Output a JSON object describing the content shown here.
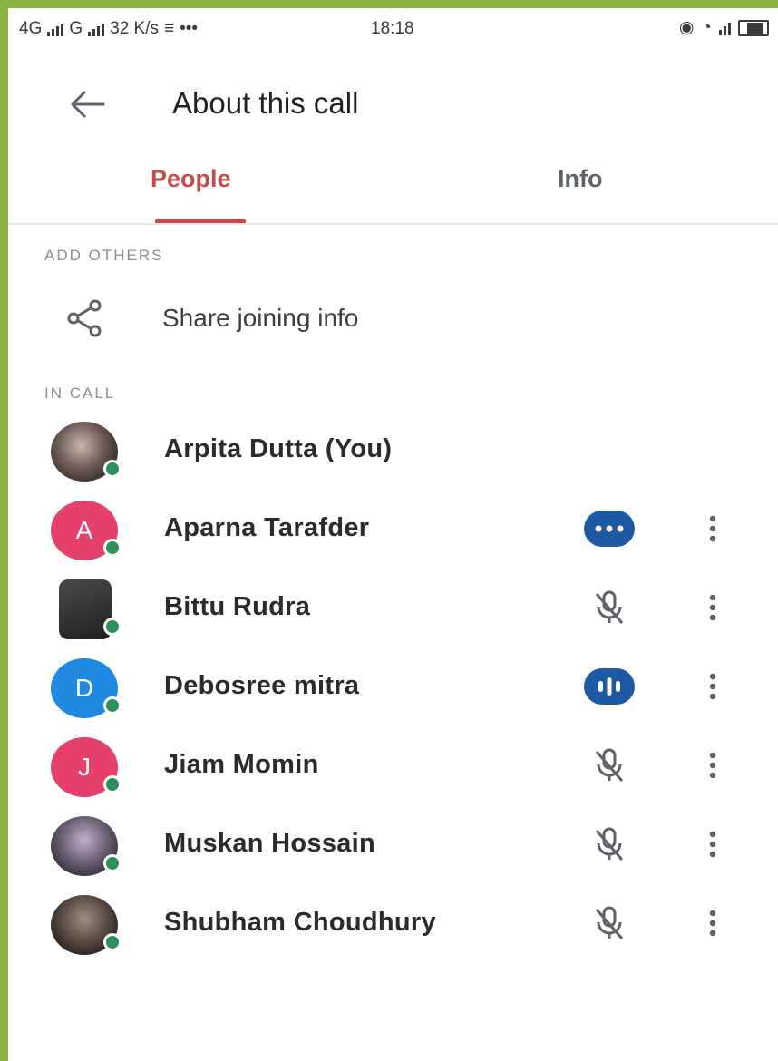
{
  "status_bar": {
    "network1": "4G",
    "network2": "G",
    "speed": "32 K/s",
    "dots": "•••",
    "time": "18:18"
  },
  "header": {
    "title": "About this call",
    "back_icon": "arrow-back-icon"
  },
  "tabs": [
    {
      "label": "People",
      "active": true
    },
    {
      "label": "Info",
      "active": false
    }
  ],
  "add_others": {
    "section_label": "ADD OTHERS",
    "share_label": "Share joining info",
    "share_icon": "share-icon"
  },
  "in_call": {
    "section_label": "IN CALL",
    "participants": [
      {
        "name": "Arpita Dutta (You)",
        "initial": "",
        "avatar": "photo",
        "status": "none"
      },
      {
        "name": "Aparna Tarafder",
        "initial": "A",
        "avatar": "pink",
        "status": "active"
      },
      {
        "name": "Bittu Rudra",
        "initial": "",
        "avatar": "photo",
        "status": "muted"
      },
      {
        "name": "Debosree mitra",
        "initial": "D",
        "avatar": "blue",
        "status": "speaking"
      },
      {
        "name": "Jiam Momin",
        "initial": "J",
        "avatar": "pink",
        "status": "muted"
      },
      {
        "name": "Muskan Hossain",
        "initial": "",
        "avatar": "photo",
        "status": "muted"
      },
      {
        "name": "Shubham Choudhury",
        "initial": "",
        "avatar": "photo",
        "status": "muted"
      }
    ]
  },
  "colors": {
    "accent": "#c64b4b",
    "speaking_pill": "#1d5aa3",
    "online": "#2d8f5a",
    "frame": "#8ab43f"
  }
}
